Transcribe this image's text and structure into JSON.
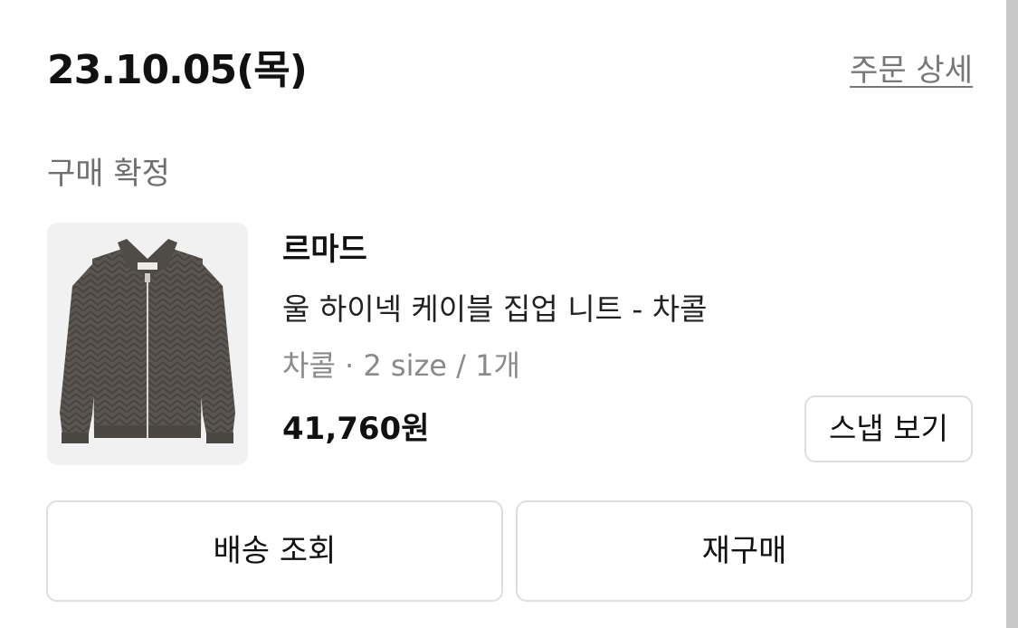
{
  "order": {
    "date": "23.10.05(목)",
    "detail_link": "주문 상세",
    "status": "구매 확정"
  },
  "product": {
    "image_icon": "cardigan-image",
    "brand": "르마드",
    "name": "울 하이넥 케이블 집업 니트 - 차콜",
    "option": "차콜 · 2 size / 1개",
    "price": "41,760원",
    "snap_button": "스냅 보기"
  },
  "actions": {
    "delivery": "배송 조회",
    "reorder": "재구매"
  },
  "colors": {
    "knit": "#5a5550",
    "thumb_background": "#f1f1f1",
    "border": "#dedede"
  }
}
